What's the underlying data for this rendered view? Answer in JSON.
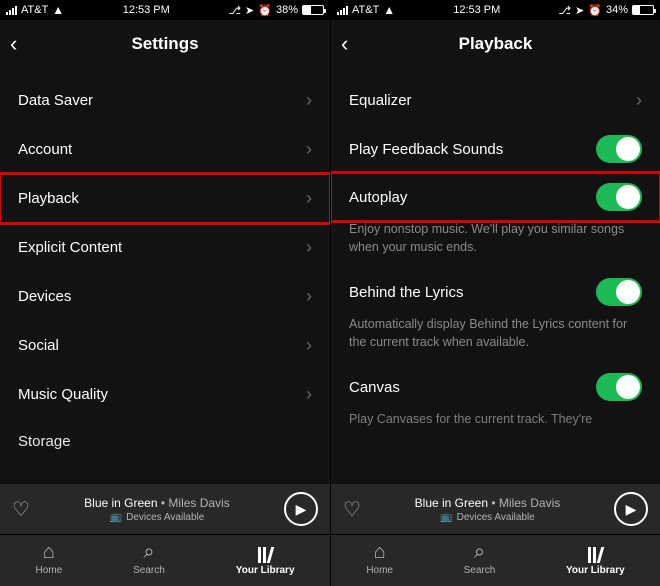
{
  "left": {
    "status": {
      "carrier": "AT&T",
      "time": "12:53 PM",
      "battery_pct": "38%"
    },
    "header": {
      "title": "Settings"
    },
    "items": [
      {
        "label": "Data Saver"
      },
      {
        "label": "Account"
      },
      {
        "label": "Playback"
      },
      {
        "label": "Explicit Content"
      },
      {
        "label": "Devices"
      },
      {
        "label": "Social"
      },
      {
        "label": "Music Quality"
      },
      {
        "label": "Storage"
      }
    ]
  },
  "right": {
    "status": {
      "carrier": "AT&T",
      "time": "12:53 PM",
      "battery_pct": "34%"
    },
    "header": {
      "title": "Playback"
    },
    "equalizer": {
      "label": "Equalizer"
    },
    "feedback": {
      "label": "Play Feedback Sounds"
    },
    "autoplay": {
      "label": "Autoplay",
      "desc": "Enjoy nonstop music. We'll play you similar songs when your music ends."
    },
    "lyrics": {
      "label": "Behind the Lyrics",
      "desc": "Automatically display Behind the Lyrics content for the current track when available."
    },
    "canvas": {
      "label": "Canvas",
      "desc": "Play Canvases for the current track. They're"
    }
  },
  "player": {
    "track": "Blue in Green",
    "separator": " • ",
    "artist": "Miles Davis",
    "devices": "Devices Available"
  },
  "nav": {
    "home": "Home",
    "search": "Search",
    "library": "Your Library"
  }
}
